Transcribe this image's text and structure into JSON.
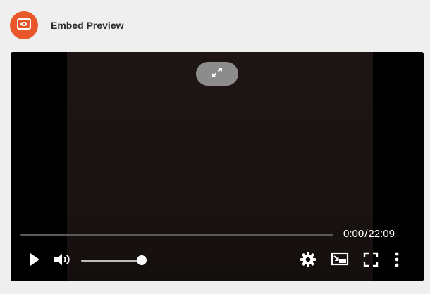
{
  "header": {
    "title": "Embed Preview",
    "logo_icon": "eye-screen-icon",
    "logo_color": "#e8582b"
  },
  "player": {
    "current_time": "0:00",
    "separator": "/",
    "duration": "22:09",
    "progress_fraction": 0.0,
    "volume_fraction": 1.0,
    "controls": {
      "expand_icon": "expand-arrows-icon",
      "play_icon": "play-icon",
      "volume_icon": "volume-icon",
      "settings_icon": "gear-icon",
      "pip_icon": "picture-in-picture-icon",
      "fullscreen_icon": "fullscreen-icon",
      "more_icon": "more-vertical-icon"
    }
  }
}
